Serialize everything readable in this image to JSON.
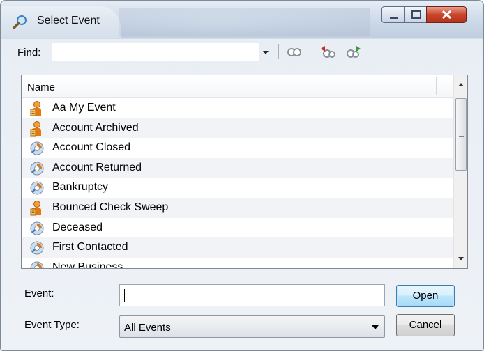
{
  "window": {
    "title": "Select Event",
    "icon": "magnifier-icon"
  },
  "toolbar": {
    "find_label": "Find:",
    "find_value": "",
    "tools": [
      "find-next-icon",
      "find-previous-icon",
      "find-forward-icon"
    ]
  },
  "list": {
    "column_header": "Name",
    "items": [
      {
        "label": "Aa My Event",
        "icon": "user-event-icon"
      },
      {
        "label": "Account Archived",
        "icon": "user-event-icon"
      },
      {
        "label": "Account Closed",
        "icon": "system-event-icon"
      },
      {
        "label": "Account Returned",
        "icon": "system-event-icon"
      },
      {
        "label": "Bankruptcy",
        "icon": "system-event-icon"
      },
      {
        "label": "Bounced Check Sweep",
        "icon": "user-event-icon"
      },
      {
        "label": "Deceased",
        "icon": "system-event-icon"
      },
      {
        "label": "First Contacted",
        "icon": "system-event-icon"
      },
      {
        "label": "New Business",
        "icon": "system-event-icon"
      }
    ]
  },
  "form": {
    "event_label": "Event:",
    "event_value": "",
    "event_type_label": "Event Type:",
    "event_type_value": "All Events"
  },
  "buttons": {
    "open": "Open",
    "cancel": "Cancel"
  },
  "colors": {
    "accent_border": "#3c7fb1",
    "close_button": "#c9452a",
    "row_alt": "#f1f3f6"
  }
}
